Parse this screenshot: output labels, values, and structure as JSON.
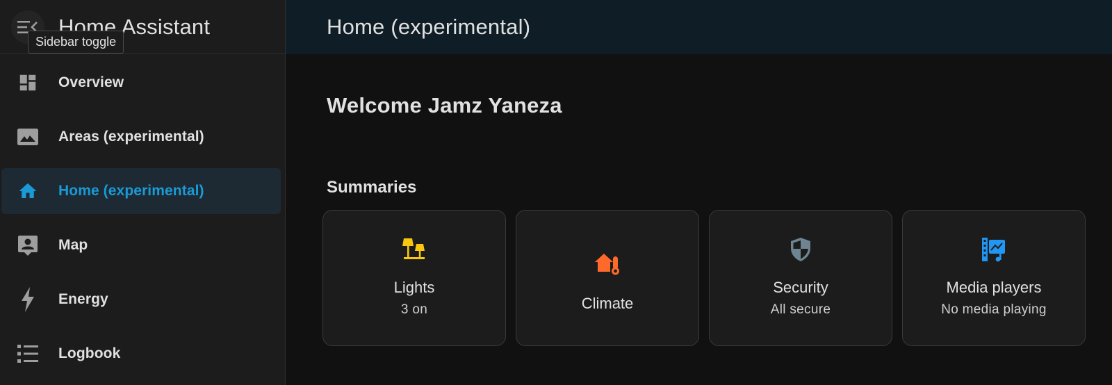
{
  "sidebar": {
    "app_title": "Home Assistant",
    "tooltip": "Sidebar toggle",
    "items": [
      {
        "label": "Overview",
        "icon": "dashboard-icon",
        "active": false
      },
      {
        "label": "Areas (experimental)",
        "icon": "image-icon",
        "active": false
      },
      {
        "label": "Home (experimental)",
        "icon": "home-icon",
        "active": true
      },
      {
        "label": "Map",
        "icon": "map-account-icon",
        "active": false
      },
      {
        "label": "Energy",
        "icon": "lightning-icon",
        "active": false
      },
      {
        "label": "Logbook",
        "icon": "logbook-list-icon",
        "active": false
      }
    ]
  },
  "topbar": {
    "title": "Home (experimental)"
  },
  "main": {
    "welcome": "Welcome Jamz Yaneza",
    "section_title": "Summaries",
    "cards": [
      {
        "title": "Lights",
        "subtitle": "3 on",
        "icon": "lamps-icon",
        "color": "#f9c80e"
      },
      {
        "title": "Climate",
        "subtitle": "",
        "icon": "home-thermometer-icon",
        "color": "#ff6a2a"
      },
      {
        "title": "Security",
        "subtitle": "All secure",
        "icon": "shield-half-icon",
        "color": "#6e8591"
      },
      {
        "title": "Media players",
        "subtitle": "No media playing",
        "icon": "multimedia-icon",
        "color": "#2196f3"
      }
    ]
  },
  "colors": {
    "accent": "#1a9ad6",
    "sidebar_bg": "#1c1c1c",
    "topbar_bg": "#0f1e26",
    "page_bg": "#111111"
  }
}
